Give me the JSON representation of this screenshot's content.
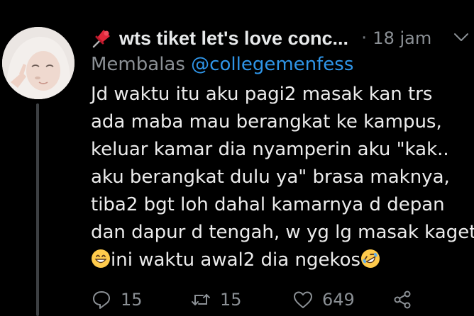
{
  "author": {
    "display_name": "wts tiket let's love conc...",
    "time": "18 jam",
    "separator": "·"
  },
  "reply": {
    "prefix": "Membalas",
    "handle": "@collegemenfess"
  },
  "tweet_text": {
    "line1": "Jd waktu itu aku pagi2 masak kan trs",
    "line2": "ada maba mau berangkat ke kampus,",
    "line3": "keluar kamar dia nyamperin aku \"kak..",
    "line4": "aku berangkat dulu ya\" brasa maknya,",
    "line5": "tiba2 bgt loh dahal kamarnya d depan",
    "line6": "dan dapur d tengah, w yg lg masak kaget",
    "line7": "ini waktu awal2 dia ngekos"
  },
  "actions": {
    "reply_count": "15",
    "retweet_count": "15",
    "like_count": "649"
  },
  "colors": {
    "background": "#000000",
    "link": "#2f95e8",
    "muted": "#8b9095"
  },
  "icons": [
    "pushpin-icon",
    "chevron-down-icon",
    "grinning-emoji-icon",
    "rofl-emoji-icon",
    "reply-icon",
    "retweet-icon",
    "like-icon",
    "share-icon"
  ]
}
